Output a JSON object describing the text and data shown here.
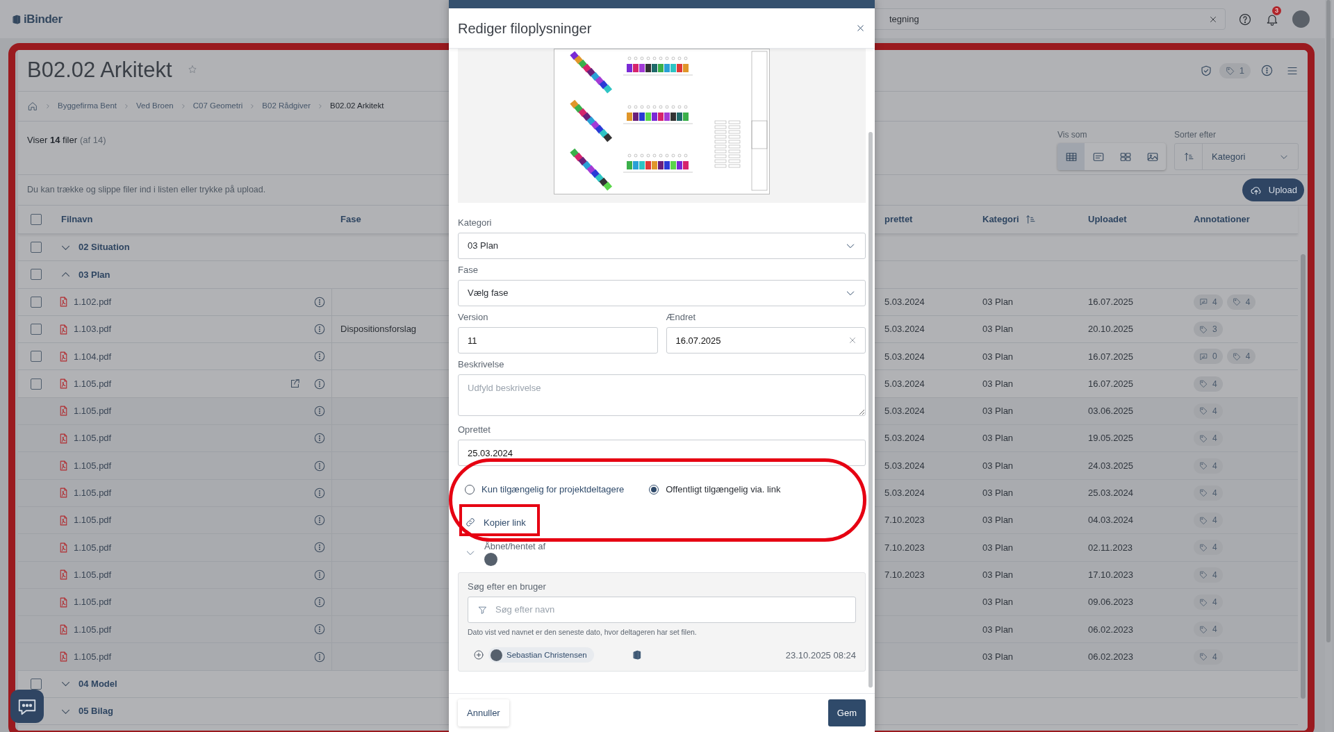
{
  "header": {
    "logo": "iBinder",
    "search": {
      "value": "tegning"
    },
    "notification_count": "3"
  },
  "folder": {
    "title": "B02.02 Arkitekt",
    "favorite": false,
    "tag_count": "1",
    "breadcrumbs": [
      "Byggefirma Bent",
      "Ved Broen",
      "C07 Geometri",
      "B02 Rådgiver",
      "B02.02 Arkitekt"
    ],
    "summary": "Viser **14** filer",
    "summary_total": "(af 14)",
    "view_label": "Vis som",
    "view_modes": [
      {
        "kind": "table",
        "selected": true
      },
      {
        "kind": "list",
        "selected": false
      },
      {
        "kind": "tiles",
        "selected": false
      },
      {
        "kind": "gallery",
        "selected": false
      }
    ],
    "sort_label": "Sorter efter",
    "sort_value": "Kategori",
    "hint": "Du kan trække og slippe filer ind i listen eller trykke på upload.",
    "upload": "Upload"
  },
  "table": {
    "all_checked": false,
    "columns": [
      {
        "label": "Filnavn",
        "sorted": false
      },
      {
        "label": "Fase",
        "sorted": false
      },
      {
        "label": "prettet",
        "sorted": false
      },
      {
        "label": "Kategori",
        "sorted": true
      },
      {
        "label": "Uploadet",
        "sorted": false
      },
      {
        "label": "Annotationer",
        "sorted": false
      }
    ],
    "rows": [
      {
        "kind": "group",
        "label": "02 Situation",
        "expanded": false,
        "checked": false
      },
      {
        "kind": "group",
        "label": "03 Plan",
        "expanded": true,
        "checked": false
      },
      {
        "kind": "file",
        "name": "1.102.pdf",
        "checked": false,
        "shared": false,
        "oprettet": "5.03.2024",
        "kategori": "03 Plan",
        "uploadet": "16.07.2025",
        "annotations": [
          {
            "kind": "comment",
            "count": "4"
          },
          {
            "kind": "tag",
            "count": "4"
          }
        ]
      },
      {
        "kind": "file",
        "name": "1.103.pdf",
        "checked": false,
        "shared": false,
        "fase": "Dispositionsforslag",
        "oprettet": "5.03.2024",
        "kategori": "03 Plan",
        "uploadet": "20.10.2025",
        "annotations": [
          {
            "kind": "tag",
            "count": "3"
          }
        ]
      },
      {
        "kind": "file",
        "name": "1.104.pdf",
        "checked": false,
        "shared": false,
        "oprettet": "5.03.2024",
        "kategori": "03 Plan",
        "uploadet": "16.07.2025",
        "annotations": [
          {
            "kind": "comment",
            "count": "0"
          },
          {
            "kind": "tag",
            "count": "4"
          }
        ]
      },
      {
        "kind": "file",
        "name": "1.105.pdf",
        "checked": false,
        "shared": true,
        "oprettet": "5.03.2024",
        "kategori": "03 Plan",
        "uploadet": "16.07.2025",
        "annotations": [
          {
            "kind": "tag",
            "count": "4"
          }
        ]
      },
      {
        "kind": "version",
        "name": "1.105.pdf",
        "shared": false,
        "oprettet": "5.03.2024",
        "kategori": "03 Plan",
        "uploadet": "03.06.2025",
        "annotations": [
          {
            "kind": "tag",
            "count": "4"
          }
        ]
      },
      {
        "kind": "version",
        "name": "1.105.pdf",
        "shared": false,
        "oprettet": "5.03.2024",
        "kategori": "03 Plan",
        "uploadet": "19.05.2025",
        "annotations": [
          {
            "kind": "tag",
            "count": "4"
          }
        ]
      },
      {
        "kind": "version",
        "name": "1.105.pdf",
        "shared": false,
        "oprettet": "5.03.2024",
        "kategori": "03 Plan",
        "uploadet": "24.03.2025",
        "annotations": [
          {
            "kind": "tag",
            "count": "4"
          }
        ]
      },
      {
        "kind": "version",
        "name": "1.105.pdf",
        "shared": false,
        "oprettet": "5.03.2024",
        "kategori": "03 Plan",
        "uploadet": "25.03.2024",
        "annotations": [
          {
            "kind": "tag",
            "count": "4"
          }
        ]
      },
      {
        "kind": "version",
        "name": "1.105.pdf",
        "shared": false,
        "oprettet": "7.10.2023",
        "kategori": "03 Plan",
        "uploadet": "04.03.2024",
        "annotations": [
          {
            "kind": "tag",
            "count": "4"
          }
        ]
      },
      {
        "kind": "version",
        "name": "1.105.pdf",
        "shared": false,
        "oprettet": "7.10.2023",
        "kategori": "03 Plan",
        "uploadet": "02.11.2023",
        "annotations": [
          {
            "kind": "tag",
            "count": "4"
          }
        ]
      },
      {
        "kind": "version",
        "name": "1.105.pdf",
        "shared": false,
        "oprettet": "7.10.2023",
        "kategori": "03 Plan",
        "uploadet": "17.10.2023",
        "annotations": [
          {
            "kind": "tag",
            "count": "4"
          }
        ]
      },
      {
        "kind": "version",
        "name": "1.105.pdf",
        "shared": false,
        "kategori": "03 Plan",
        "uploadet": "09.06.2023",
        "annotations": [
          {
            "kind": "tag",
            "count": "4"
          }
        ]
      },
      {
        "kind": "version",
        "name": "1.105.pdf",
        "shared": false,
        "kategori": "03 Plan",
        "uploadet": "06.02.2023",
        "annotations": [
          {
            "kind": "tag",
            "count": "4"
          }
        ]
      },
      {
        "kind": "version",
        "name": "1.105.pdf",
        "shared": false,
        "kategori": "03 Plan",
        "uploadet": "06.02.2023",
        "annotations": [
          {
            "kind": "tag",
            "count": "4"
          }
        ]
      },
      {
        "kind": "group",
        "label": "04 Model",
        "expanded": false,
        "checked": false
      },
      {
        "kind": "group",
        "label": "05 Bilag",
        "expanded": false
      }
    ]
  },
  "modal": {
    "title": "Rediger filoplysninger",
    "kategori": {
      "label": "Kategori",
      "value": "03 Plan"
    },
    "fase": {
      "label": "Fase",
      "value": "Vælg fase"
    },
    "version": {
      "label": "Version",
      "value": "11"
    },
    "aendret": {
      "label": "Ændret",
      "value": "16.07.2025"
    },
    "beskrivelse": {
      "label": "Beskrivelse",
      "placeholder": "Udfyld beskrivelse"
    },
    "oprettet": {
      "label": "Oprettet",
      "value": "25.03.2024"
    },
    "access": [
      {
        "label": "Kun tilgængelig for projektdeltagere",
        "selected": false
      },
      {
        "label": "Offentligt tilgængelig via. link",
        "selected": true
      }
    ],
    "copy_link": "Kopier link",
    "opened_by": {
      "label": "Åbnet/hentet af",
      "expanded": false
    },
    "user_search": {
      "label": "Søg efter en bruger",
      "placeholder": "Søg efter navn",
      "hint": "Dato vist ved navnet er den seneste dato, hvor deltageren har set filen.",
      "users": [
        {
          "name": "Sebastian Christensen",
          "date": "23.10.2025 08:24"
        }
      ]
    },
    "cancel": "Annuller",
    "save": "Gem"
  }
}
